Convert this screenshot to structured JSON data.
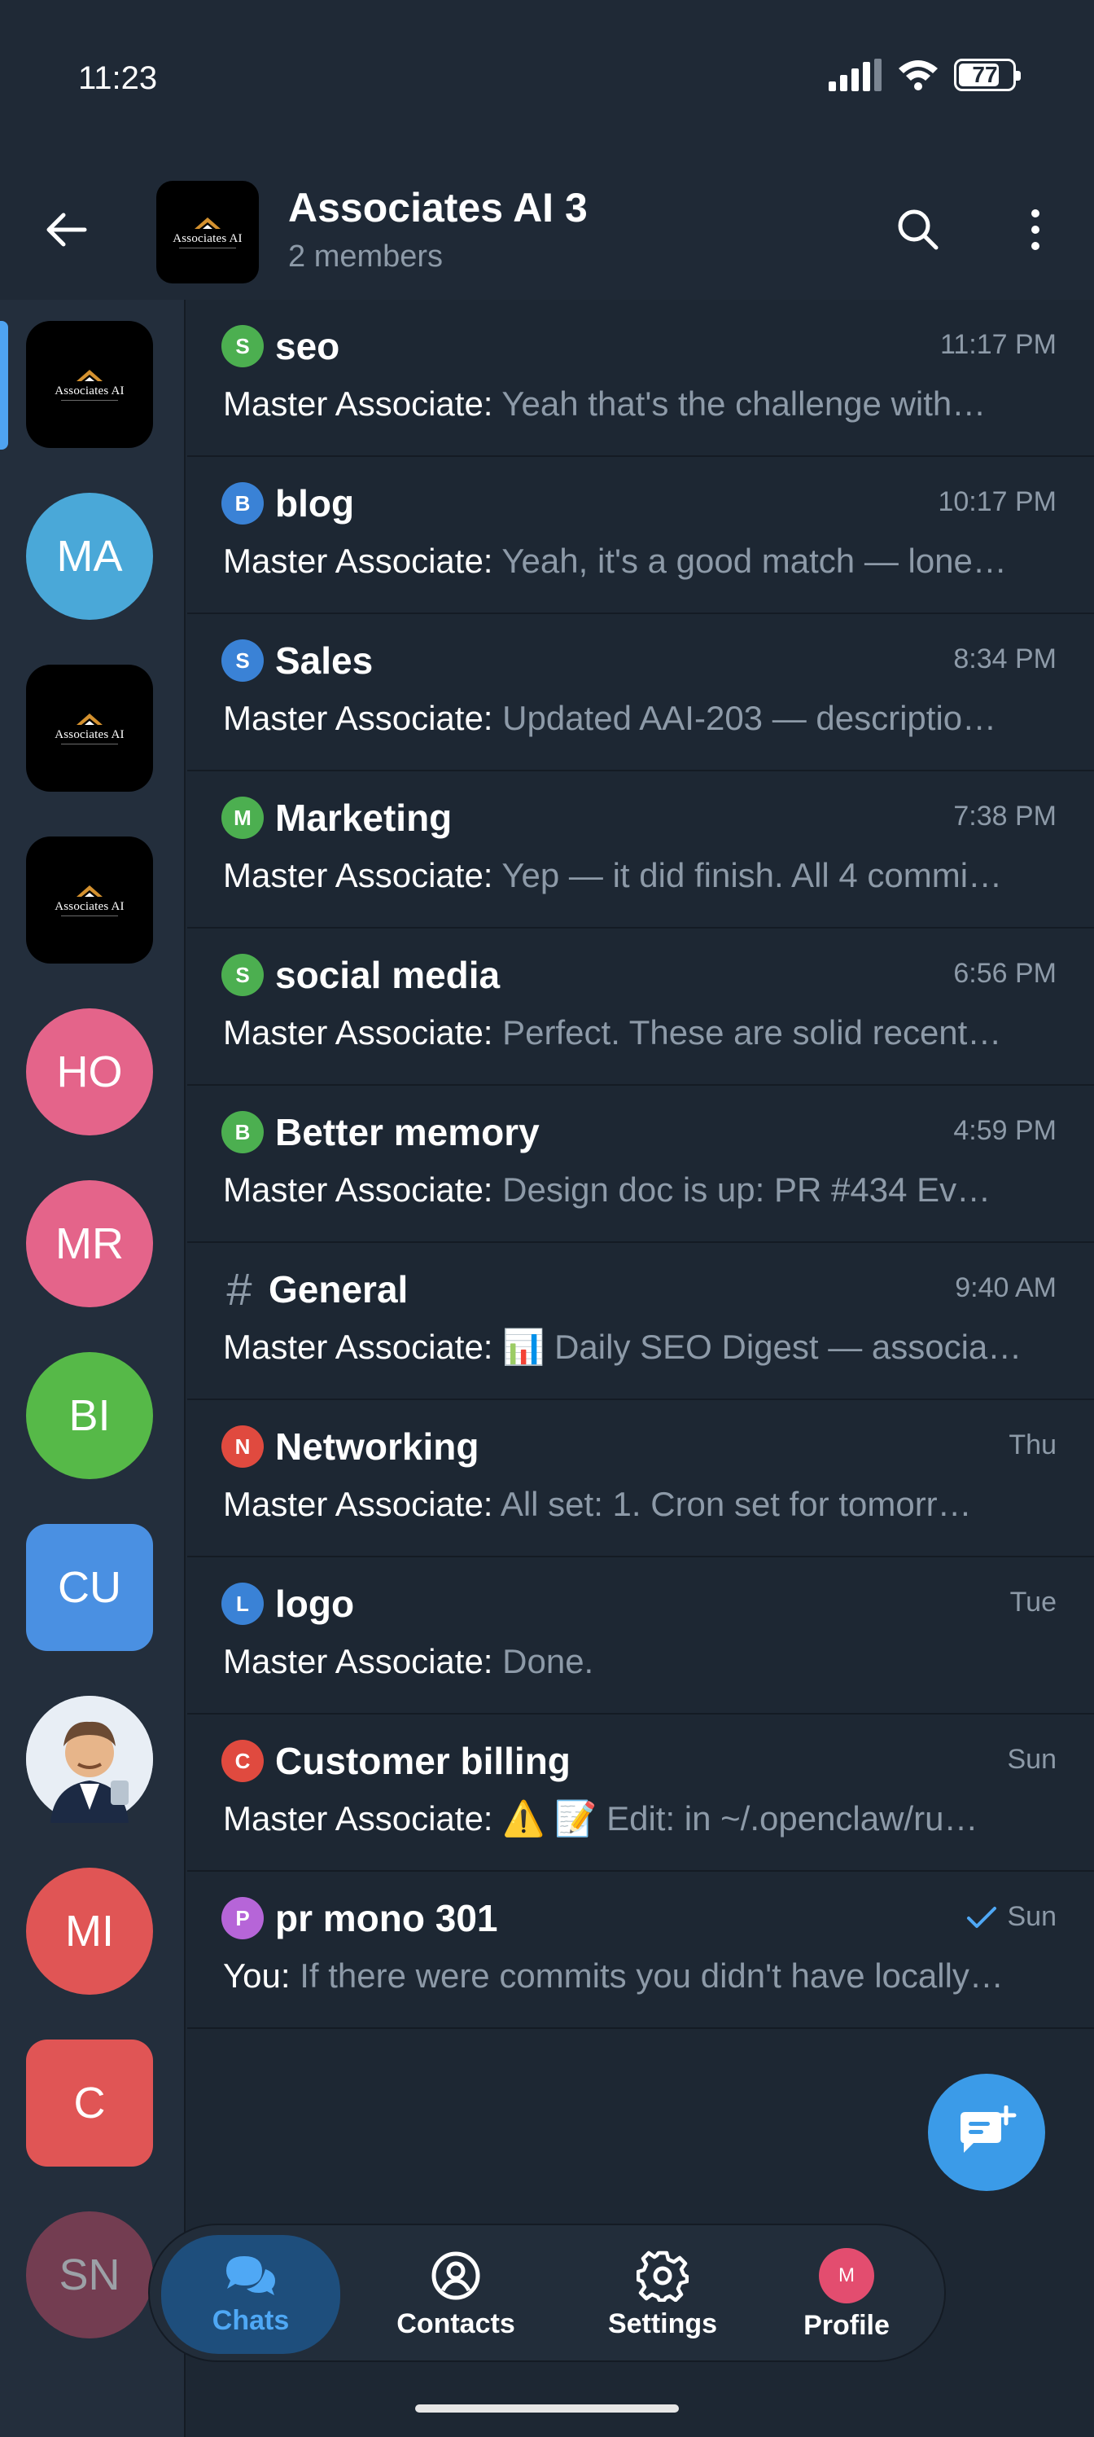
{
  "status_bar": {
    "time": "11:23",
    "battery": "77",
    "battery_level": 0.77
  },
  "header": {
    "title": "Associates AI 3",
    "subtitle": "2 members"
  },
  "logo_text": "Associates AI",
  "rail": {
    "items": [
      {
        "type": "logo",
        "label": ""
      },
      {
        "type": "initials",
        "label": "MA",
        "color": "#4aa8d8"
      },
      {
        "type": "logo",
        "label": ""
      },
      {
        "type": "logo",
        "label": ""
      },
      {
        "type": "initials",
        "label": "HO",
        "color": "#e4648a"
      },
      {
        "type": "initials",
        "label": "MR",
        "color": "#e4648a"
      },
      {
        "type": "initials",
        "label": "BI",
        "color": "#56b948"
      },
      {
        "type": "initials",
        "label": "CU",
        "color": "#4a90e2"
      },
      {
        "type": "photo",
        "label": ""
      },
      {
        "type": "initials",
        "label": "MI",
        "color": "#e05555"
      },
      {
        "type": "initials",
        "label": "C",
        "color": "#e05555"
      },
      {
        "type": "initials",
        "label": "SN",
        "color": "#b54b63"
      }
    ]
  },
  "chats": [
    {
      "badge": "S",
      "badge_color": "#4caf50",
      "title": "seo",
      "time": "11:17 PM",
      "sender": "Master Associate:",
      "preview": "Yeah that's the challenge with…"
    },
    {
      "badge": "B",
      "badge_color": "#3a82d6",
      "title": "blog",
      "time": "10:17 PM",
      "sender": "Master Associate:",
      "preview": "Yeah, it's a good match — lone…"
    },
    {
      "badge": "S",
      "badge_color": "#3a82d6",
      "title": "Sales",
      "time": "8:34 PM",
      "sender": "Master Associate:",
      "preview": "Updated AAI-203 — descriptio…"
    },
    {
      "badge": "M",
      "badge_color": "#4caf50",
      "title": "Marketing",
      "time": "7:38 PM",
      "sender": "Master Associate:",
      "preview": "Yep — it did finish. All 4 commi…"
    },
    {
      "badge": "S",
      "badge_color": "#4caf50",
      "title": "social media",
      "time": "6:56 PM",
      "sender": "Master Associate:",
      "preview": "Perfect. These are solid recent…"
    },
    {
      "badge": "B",
      "badge_color": "#4caf50",
      "title": "Better memory",
      "time": "4:59 PM",
      "sender": "Master Associate:",
      "preview": "Design doc is up: PR #434  Ev…"
    },
    {
      "badge": "#",
      "badge_color": "",
      "title": "General",
      "time": "9:40 AM",
      "sender": "Master Associate:",
      "preview": "📊 Daily SEO Digest — associa…"
    },
    {
      "badge": "N",
      "badge_color": "#e04a3f",
      "title": "Networking",
      "time": "Thu",
      "sender": "Master Associate:",
      "preview": "All set:  1. Cron set for tomorr…"
    },
    {
      "badge": "L",
      "badge_color": "#3a82d6",
      "title": "logo",
      "time": "Tue",
      "sender": "Master Associate:",
      "preview": "Done."
    },
    {
      "badge": "C",
      "badge_color": "#e04a3f",
      "title": "Customer billing",
      "time": "Sun",
      "sender": "Master Associate:",
      "preview": "⚠️ 📝 Edit: in ~/.openclaw/ru…"
    },
    {
      "badge": "P",
      "badge_color": "#b665d8",
      "title": "pr mono 301",
      "time": "Sun",
      "sender": "You:",
      "preview": "If there were commits you didn't have locally…",
      "read": true
    }
  ],
  "nav": {
    "chats": "Chats",
    "contacts": "Contacts",
    "settings": "Settings",
    "profile": "Profile",
    "profile_initial": "M"
  }
}
